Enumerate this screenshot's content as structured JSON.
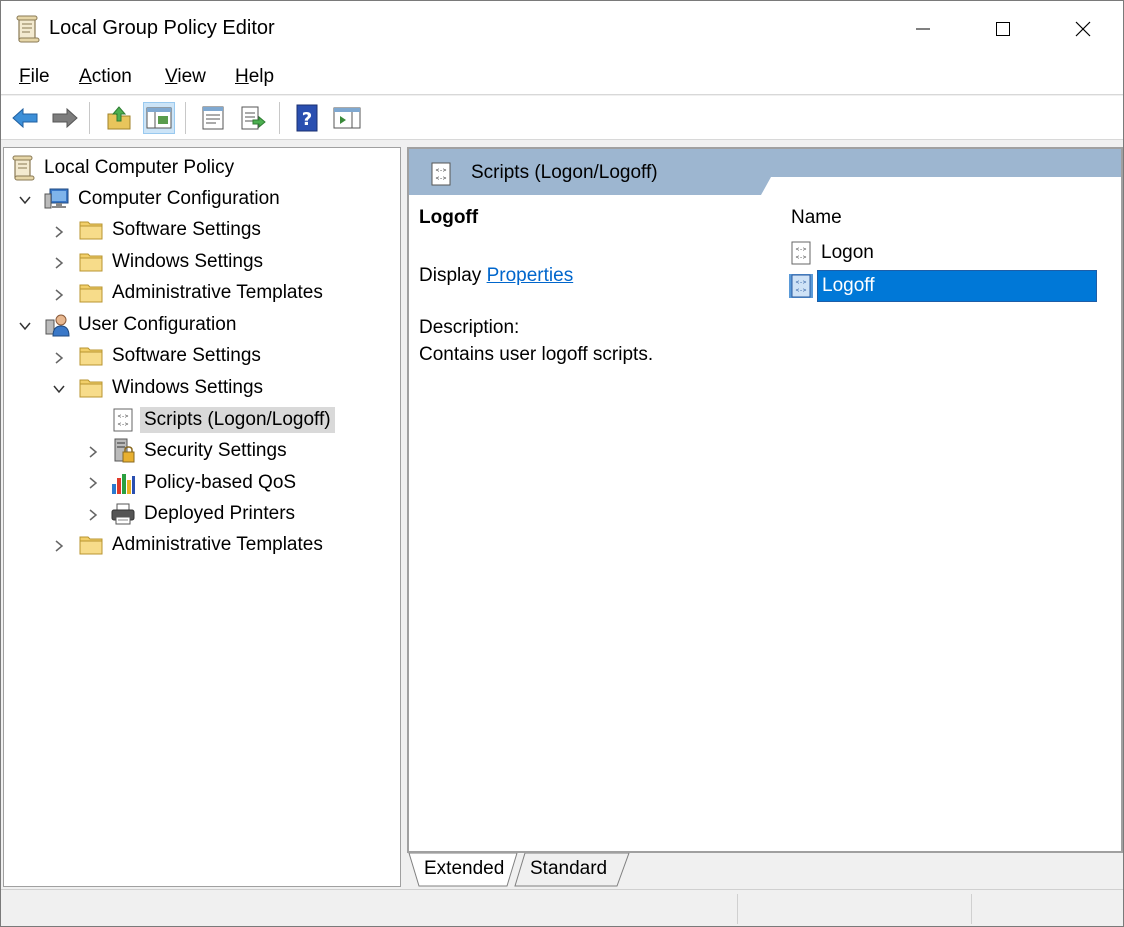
{
  "window": {
    "title": "Local Group Policy Editor",
    "icon": "policy-scroll-icon"
  },
  "menu": {
    "items": [
      {
        "label": "File",
        "underline": "F",
        "rest": "ile"
      },
      {
        "label": "Action",
        "underline": "A",
        "rest": "ction"
      },
      {
        "label": "View",
        "underline": "V",
        "rest": "iew"
      },
      {
        "label": "Help",
        "underline": "H",
        "rest": "elp"
      }
    ]
  },
  "toolbar": {
    "buttons": [
      "back-arrow-icon",
      "forward-arrow-icon",
      "up-folder-icon",
      "show-hide-tree-icon",
      "properties-icon",
      "export-list-icon",
      "help-icon",
      "show-action-pane-icon"
    ]
  },
  "tree": {
    "root": "Local Computer Policy",
    "computer_config": "Computer Configuration",
    "cc_software": "Software Settings",
    "cc_windows": "Windows Settings",
    "cc_admin": "Administrative Templates",
    "user_config": "User Configuration",
    "uc_software": "Software Settings",
    "uc_windows": "Windows Settings",
    "uc_scripts": "Scripts (Logon/Logoff)",
    "uc_security": "Security Settings",
    "uc_qos": "Policy-based QoS",
    "uc_printers": "Deployed Printers",
    "uc_admin": "Administrative Templates"
  },
  "right_pane": {
    "header_title": "Scripts (Logon/Logoff)",
    "selected_title": "Logoff",
    "display_prefix": "Display",
    "display_link": "Properties",
    "description_label": "Description:",
    "description_text": "Contains user logoff scripts.",
    "list_header": "Name",
    "list_items": [
      "Logon",
      "Logoff"
    ],
    "selected_item": "Logoff"
  },
  "tabs": {
    "extended": "Extended",
    "standard": "Standard",
    "active": "Extended"
  },
  "colors": {
    "header_blue": "#9db6d0",
    "selection_blue": "#0078d7",
    "link_blue": "#0066cc"
  }
}
